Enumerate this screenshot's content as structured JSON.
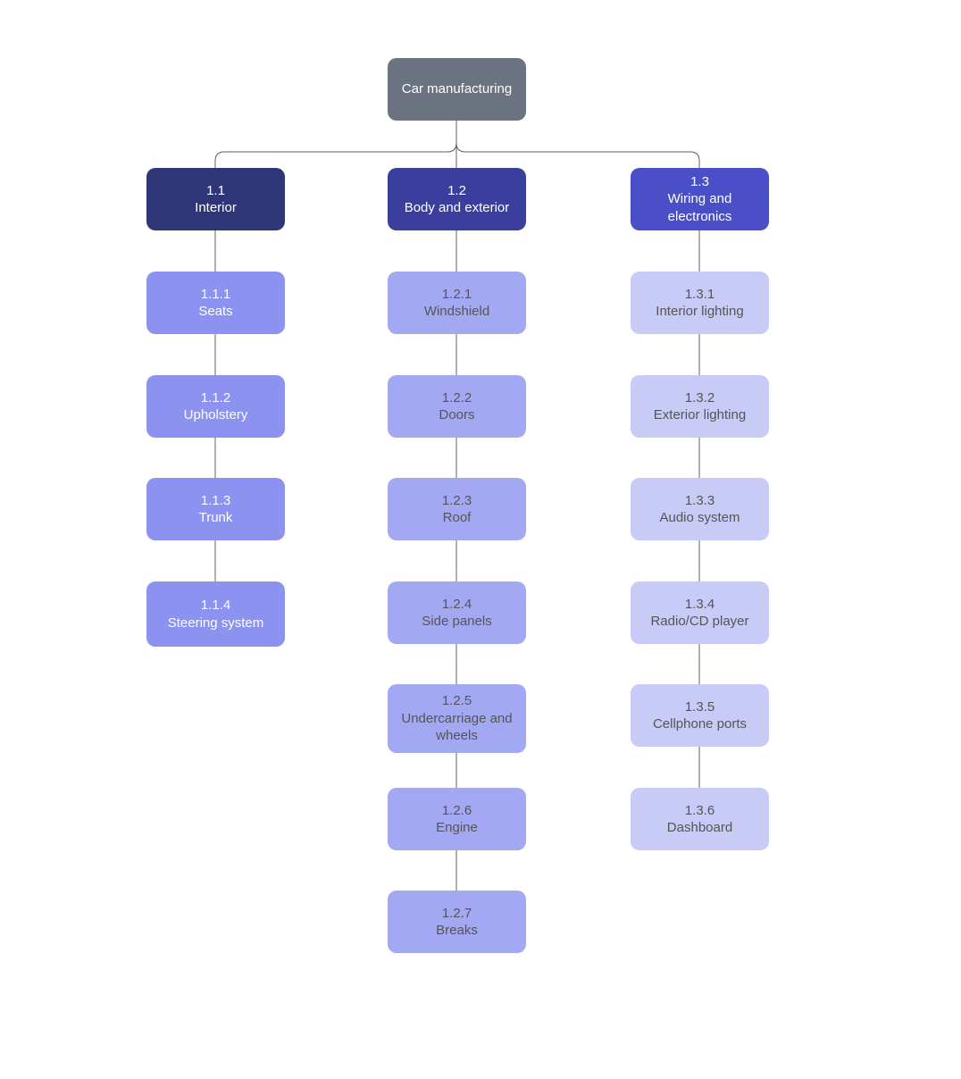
{
  "root": {
    "label": "Car manufacturing"
  },
  "branches": [
    {
      "num": "1.1",
      "label": "Interior",
      "children": [
        {
          "num": "1.1.1",
          "label": "Seats"
        },
        {
          "num": "1.1.2",
          "label": "Upholstery"
        },
        {
          "num": "1.1.3",
          "label": "Trunk"
        },
        {
          "num": "1.1.4",
          "label": "Steering system"
        }
      ]
    },
    {
      "num": "1.2",
      "label": "Body and exterior",
      "children": [
        {
          "num": "1.2.1",
          "label": "Windshield"
        },
        {
          "num": "1.2.2",
          "label": "Doors"
        },
        {
          "num": "1.2.3",
          "label": "Roof"
        },
        {
          "num": "1.2.4",
          "label": "Side panels"
        },
        {
          "num": "1.2.5",
          "label": "Undercarriage and wheels"
        },
        {
          "num": "1.2.6",
          "label": "Engine"
        },
        {
          "num": "1.2.7",
          "label": "Breaks"
        }
      ]
    },
    {
      "num": "1.3",
      "label": "Wiring and electronics",
      "children": [
        {
          "num": "1.3.1",
          "label": "Interior lighting"
        },
        {
          "num": "1.3.2",
          "label": "Exterior lighting"
        },
        {
          "num": "1.3.3",
          "label": "Audio system"
        },
        {
          "num": "1.3.4",
          "label": "Radio/CD player"
        },
        {
          "num": "1.3.5",
          "label": "Cellphone ports"
        },
        {
          "num": "1.3.6",
          "label": "Dashboard"
        }
      ]
    }
  ],
  "chart_data": {
    "type": "tree",
    "title": "Car manufacturing",
    "root": "Car manufacturing",
    "nodes": [
      {
        "id": "1.1",
        "label": "Interior",
        "parent": "root"
      },
      {
        "id": "1.2",
        "label": "Body and exterior",
        "parent": "root"
      },
      {
        "id": "1.3",
        "label": "Wiring and electronics",
        "parent": "root"
      },
      {
        "id": "1.1.1",
        "label": "Seats",
        "parent": "1.1"
      },
      {
        "id": "1.1.2",
        "label": "Upholstery",
        "parent": "1.1"
      },
      {
        "id": "1.1.3",
        "label": "Trunk",
        "parent": "1.1"
      },
      {
        "id": "1.1.4",
        "label": "Steering system",
        "parent": "1.1"
      },
      {
        "id": "1.2.1",
        "label": "Windshield",
        "parent": "1.2"
      },
      {
        "id": "1.2.2",
        "label": "Doors",
        "parent": "1.2"
      },
      {
        "id": "1.2.3",
        "label": "Roof",
        "parent": "1.2"
      },
      {
        "id": "1.2.4",
        "label": "Side panels",
        "parent": "1.2"
      },
      {
        "id": "1.2.5",
        "label": "Undercarriage and wheels",
        "parent": "1.2"
      },
      {
        "id": "1.2.6",
        "label": "Engine",
        "parent": "1.2"
      },
      {
        "id": "1.2.7",
        "label": "Breaks",
        "parent": "1.2"
      },
      {
        "id": "1.3.1",
        "label": "Interior lighting",
        "parent": "1.3"
      },
      {
        "id": "1.3.2",
        "label": "Exterior lighting",
        "parent": "1.3"
      },
      {
        "id": "1.3.3",
        "label": "Audio system",
        "parent": "1.3"
      },
      {
        "id": "1.3.4",
        "label": "Radio/CD player",
        "parent": "1.3"
      },
      {
        "id": "1.3.5",
        "label": "Cellphone ports",
        "parent": "1.3"
      },
      {
        "id": "1.3.6",
        "label": "Dashboard",
        "parent": "1.3"
      }
    ]
  }
}
